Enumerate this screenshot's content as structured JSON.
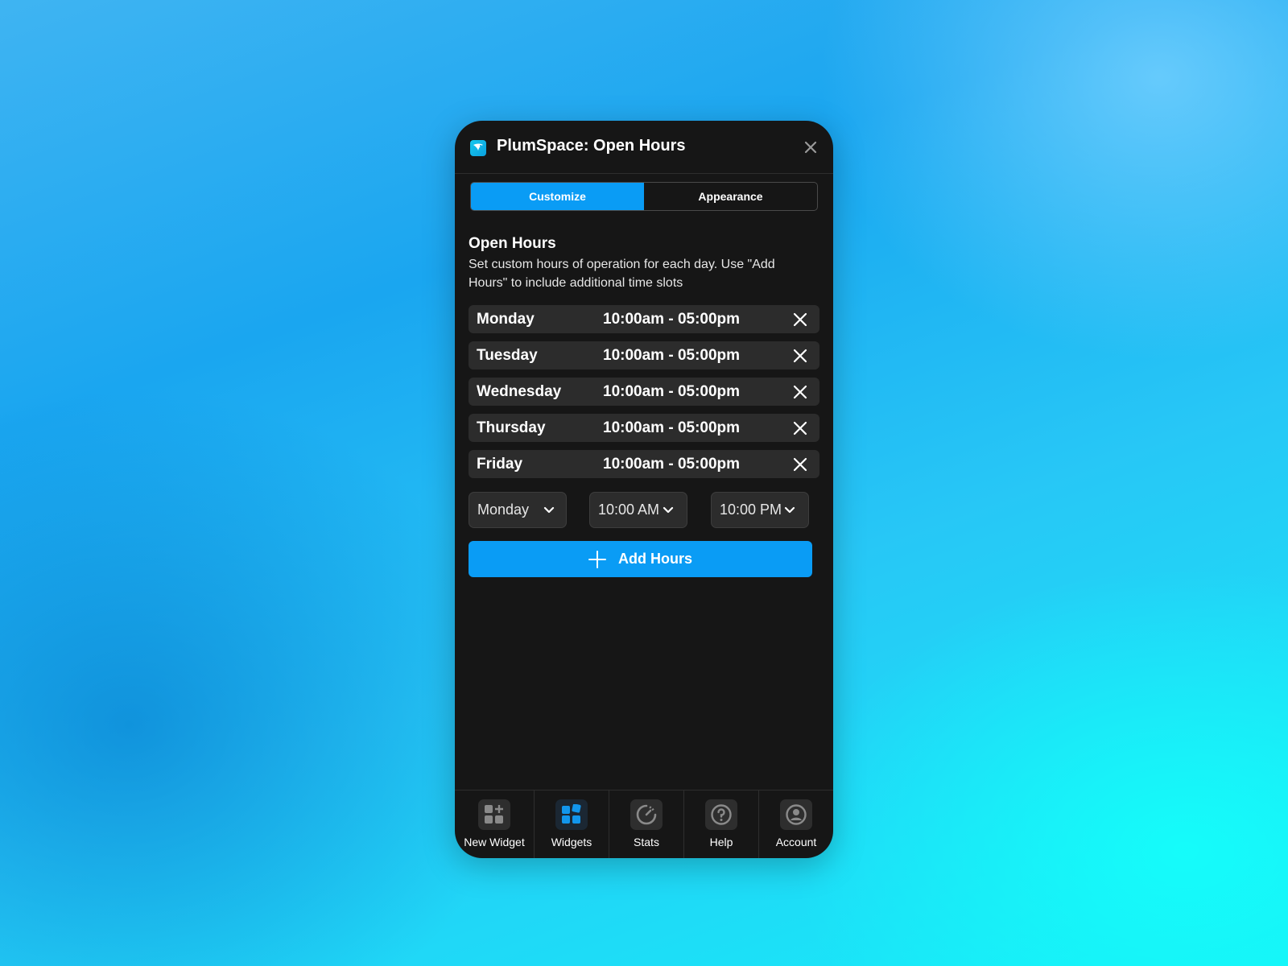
{
  "app": {
    "title": "PlumSpace: Open Hours"
  },
  "tabs": [
    {
      "label": "Customize",
      "active": true
    },
    {
      "label": "Appearance",
      "active": false
    }
  ],
  "section": {
    "title": "Open Hours",
    "description": "Set custom hours of operation for each day. Use \"Add Hours\" to include additional time slots"
  },
  "hours": [
    {
      "day": "Monday",
      "time": "10:00am - 05:00pm"
    },
    {
      "day": "Tuesday",
      "time": "10:00am - 05:00pm"
    },
    {
      "day": "Wednesday",
      "time": "10:00am - 05:00pm"
    },
    {
      "day": "Thursday",
      "time": "10:00am - 05:00pm"
    },
    {
      "day": "Friday",
      "time": "10:00am - 05:00pm"
    }
  ],
  "selects": {
    "day": "Monday",
    "start": "10:00 AM",
    "end": "10:00 PM"
  },
  "add_button": {
    "label": "Add Hours"
  },
  "nav": [
    {
      "label": "New Widget",
      "icon": "new-widget-icon"
    },
    {
      "label": "Widgets",
      "icon": "widgets-icon",
      "active": true
    },
    {
      "label": "Stats",
      "icon": "stats-icon"
    },
    {
      "label": "Help",
      "icon": "help-icon"
    },
    {
      "label": "Account",
      "icon": "account-icon"
    }
  ],
  "colors": {
    "accent": "#0a9cf5",
    "panel": "#161616",
    "row": "#2c2c2c"
  }
}
